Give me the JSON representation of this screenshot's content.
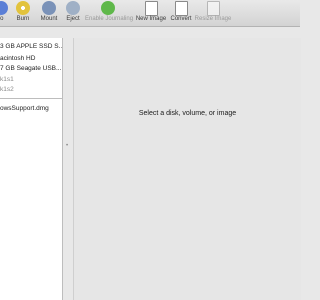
{
  "toolbar": {
    "items": [
      {
        "label": "fo",
        "enabled": true
      },
      {
        "label": "Burn",
        "enabled": true
      },
      {
        "label": "Mount",
        "enabled": true
      },
      {
        "label": "Eject",
        "enabled": true
      },
      {
        "label": "Enable Journaling",
        "enabled": false
      },
      {
        "label": "New Image",
        "enabled": true
      },
      {
        "label": "Convert",
        "enabled": true
      },
      {
        "label": "Resize Image",
        "enabled": false
      }
    ],
    "icons": [
      "info-icon",
      "burn-icon",
      "mount-icon",
      "eject-icon",
      "journaling-icon",
      "new-image-icon",
      "convert-icon",
      "resize-image-icon"
    ],
    "colors": {
      "info": "#5b7fd6",
      "burn": "#e2c33d",
      "mount": "#7a92b8",
      "eject": "#9fb0c6",
      "journaling": "#5fb84a"
    }
  },
  "sidebar": {
    "items": [
      {
        "label": "3 GB APPLE SSD S...",
        "muted": false
      },
      {
        "label": "acintosh HD",
        "muted": false
      },
      {
        "label": "7 GB Seagate USB...",
        "muted": false
      },
      {
        "label": "k1s1",
        "muted": true
      },
      {
        "label": "k1s2",
        "muted": true
      },
      {
        "label": "owsSupport.dmg",
        "muted": false
      }
    ]
  },
  "main": {
    "placeholder": "Select a disk, volume, or image"
  }
}
